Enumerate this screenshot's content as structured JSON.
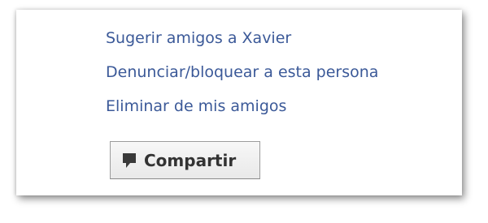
{
  "menu": {
    "items": [
      {
        "label": "Sugerir amigos a Xavier"
      },
      {
        "label": "Denunciar/bloquear a esta persona"
      },
      {
        "label": "Eliminar de mis amigos"
      }
    ]
  },
  "share_button": {
    "label": "Compartir",
    "icon": "comment-bubble-icon"
  },
  "colors": {
    "link": "#3b5998",
    "button_text": "#333333"
  }
}
